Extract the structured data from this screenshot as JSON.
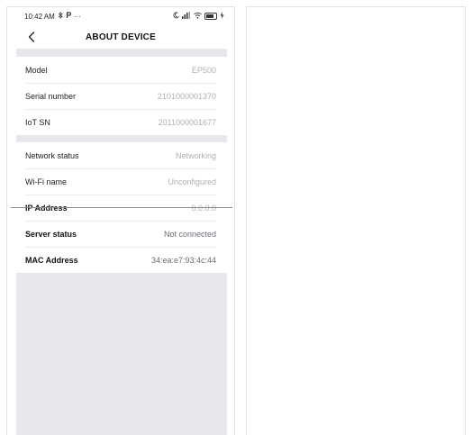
{
  "status_bar": {
    "time": "10:42 AM",
    "left_icons": [
      "bluetooth-icon",
      "p-icon",
      "more-dots-icon"
    ],
    "right_icons": [
      "moon-icon",
      "signal-icon",
      "wifi-icon",
      "battery-icon"
    ],
    "more_glyph": "···"
  },
  "header": {
    "title": "ABOUT DEVICE",
    "back_glyph": "<"
  },
  "device_info": [
    {
      "label": "Model",
      "value": "EP500"
    },
    {
      "label": "Serial number",
      "value": "2101000001370"
    },
    {
      "label": "IoT SN",
      "value": "2011000001677"
    }
  ],
  "network_info": [
    {
      "label": "Network status",
      "value": "Networking"
    },
    {
      "label": "Wi-Fi name",
      "value": "Unconfigured"
    },
    {
      "label": "IP Address",
      "value": "0.0.0.0"
    },
    {
      "label": "Server status",
      "value": "Not connected"
    },
    {
      "label": "MAC Address",
      "value": "34:ea:e7:93:4c:44"
    }
  ],
  "colors": {
    "background": "#ffffff",
    "content_gray": "#e8e8ec",
    "value_light": "#b0b0b6",
    "value_dark": "#6b6b76",
    "divider": "#ececef"
  }
}
